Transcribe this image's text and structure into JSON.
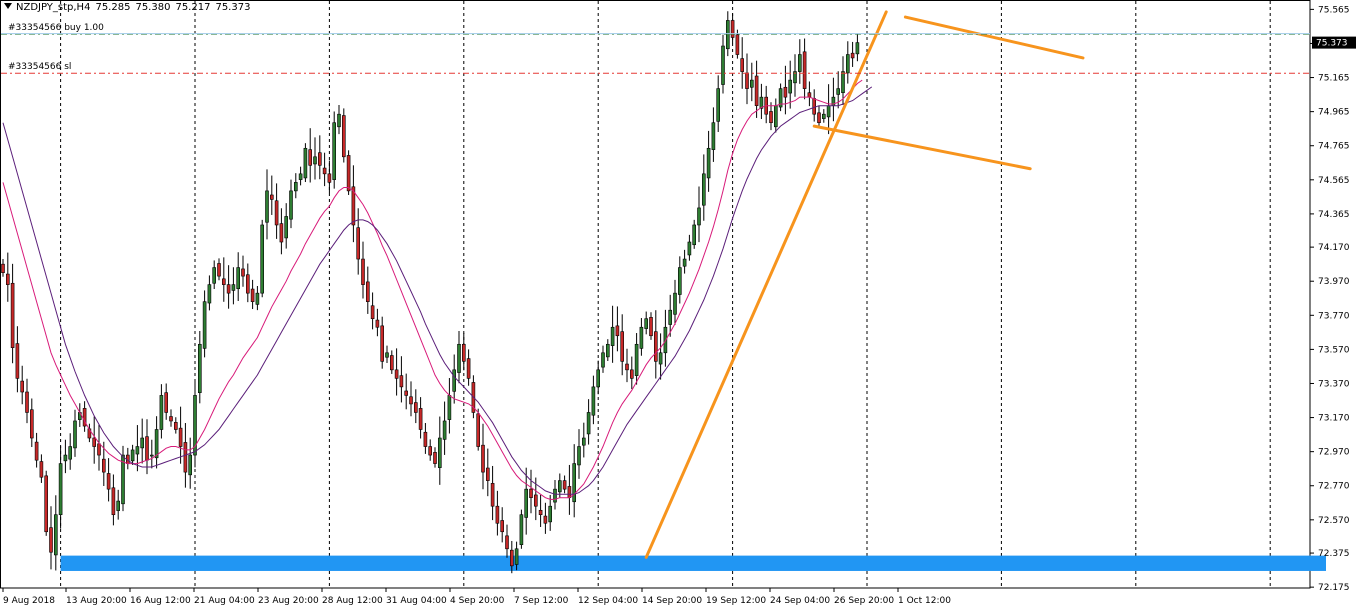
{
  "header": {
    "symbol": "NZDJPY_stp,H4",
    "open": "75.285",
    "high": "75.380",
    "low": "75.217",
    "close": "75.373"
  },
  "orders": {
    "buy_label": "#33354566 buy 1.00",
    "sl_label": "#33354566 sl",
    "buy_price": 75.42,
    "sl_price": 75.19,
    "buy_color": "#2e7d32",
    "sl_color": "#e53935"
  },
  "current_price_label": "75.373",
  "colors": {
    "bull_candle": "#2e7d32",
    "bear_candle": "#c62828",
    "ma_fast": "#d81b7a",
    "ma_slow": "#5b1f7a",
    "trendline": "#f7941d",
    "support_zone": "#2196f3",
    "grid": "#000000"
  },
  "chart_data": {
    "type": "candlestick",
    "timeframe": "H4",
    "ylim": [
      72.17,
      75.62
    ],
    "y_ticks": [
      "75.565",
      "75.365",
      "75.165",
      "74.965",
      "74.765",
      "74.565",
      "74.365",
      "74.170",
      "73.970",
      "73.770",
      "73.570",
      "73.370",
      "73.170",
      "72.970",
      "72.770",
      "72.570",
      "72.375",
      "72.175"
    ],
    "x_ticks": [
      "9 Aug 2018",
      "13 Aug 20:00",
      "16 Aug 12:00",
      "21 Aug 04:00",
      "23 Aug 20:00",
      "28 Aug 12:00",
      "31 Aug 04:00",
      "4 Sep 20:00",
      "7 Sep 12:00",
      "12 Sep 04:00",
      "14 Sep 20:00",
      "19 Sep 12:00",
      "24 Sep 04:00",
      "26 Sep 20:00",
      "1 Oct 12:00"
    ],
    "grid_x_indices": [
      12,
      40,
      68,
      96,
      124,
      152,
      180,
      208,
      236,
      264,
      292,
      320
    ],
    "support_zone": {
      "low": 72.27,
      "high": 72.36,
      "from_index": 12
    },
    "trendlines": [
      {
        "from": [
          134,
          72.35
        ],
        "to": [
          184,
          75.55
        ]
      },
      {
        "from": [
          188,
          75.52
        ],
        "to": [
          225,
          75.28
        ]
      },
      {
        "from": [
          169,
          74.88
        ],
        "to": [
          214,
          74.63
        ]
      }
    ],
    "close": [
      74.02,
      73.95,
      73.58,
      73.4,
      73.32,
      73.2,
      73.05,
      72.92,
      72.82,
      72.5,
      72.38,
      72.6,
      72.9,
      72.95,
      73.0,
      73.15,
      73.2,
      73.12,
      73.05,
      73.0,
      72.95,
      72.85,
      72.75,
      72.6,
      72.68,
      72.95,
      72.9,
      72.98,
      73.0,
      73.05,
      72.92,
      72.95,
      73.1,
      73.3,
      73.2,
      73.15,
      73.1,
      73.0,
      72.85,
      72.95,
      73.3,
      73.6,
      73.85,
      73.95,
      74.05,
      74.0,
      73.95,
      73.9,
      73.95,
      74.05,
      74.0,
      73.9,
      73.85,
      73.9,
      74.3,
      74.5,
      74.45,
      74.3,
      74.2,
      74.35,
      74.5,
      74.55,
      74.6,
      74.75,
      74.65,
      74.7,
      74.65,
      74.6,
      74.55,
      74.9,
      74.95,
      74.7,
      74.5,
      74.3,
      74.1,
      73.95,
      73.85,
      73.75,
      73.7,
      73.5,
      73.55,
      73.45,
      73.4,
      73.35,
      73.3,
      73.25,
      73.2,
      73.1,
      73.0,
      72.95,
      72.9,
      73.05,
      73.15,
      73.3,
      73.45,
      73.6,
      73.5,
      73.4,
      73.2,
      73.0,
      72.85,
      72.8,
      72.65,
      72.55,
      72.5,
      72.4,
      72.3,
      72.4,
      72.6,
      72.75,
      72.7,
      72.65,
      72.6,
      72.55,
      72.65,
      72.75,
      72.8,
      72.75,
      72.7,
      72.9,
      73.0,
      73.05,
      73.2,
      73.35,
      73.45,
      73.55,
      73.6,
      73.7,
      73.65,
      73.5,
      73.45,
      73.4,
      73.6,
      73.7,
      73.75,
      73.65,
      73.5,
      73.55,
      73.7,
      73.8,
      73.9,
      74.05,
      74.1,
      74.2,
      74.3,
      74.4,
      74.6,
      74.75,
      74.9,
      75.1,
      75.35,
      75.5,
      75.4,
      75.3,
      75.2,
      75.1,
      75.15,
      75.0,
      75.05,
      74.95,
      74.9,
      75.0,
      75.1,
      75.05,
      75.15,
      75.2,
      75.3,
      75.1,
      75.05,
      74.95,
      74.9,
      74.95,
      75.0,
      75.05,
      75.1,
      75.2,
      75.3,
      75.28,
      75.37
    ],
    "series": [
      {
        "name": "",
        "type": "moving_average",
        "values": [
          74.55,
          74.45,
          74.35,
          74.25,
          74.15,
          74.05,
          73.95,
          73.85,
          73.75,
          73.65,
          73.55,
          73.48,
          73.42,
          73.36,
          73.3,
          73.25,
          73.2,
          73.15,
          73.1,
          73.06,
          73.02,
          72.99,
          72.96,
          72.94,
          72.92,
          72.91,
          72.9,
          72.9,
          72.9,
          72.91,
          72.92,
          72.93,
          72.95,
          72.97,
          72.99,
          73.0,
          73.0,
          72.99,
          72.98,
          72.98,
          73.0,
          73.05,
          73.1,
          73.16,
          73.22,
          73.28,
          73.33,
          73.38,
          73.42,
          73.47,
          73.52,
          73.56,
          73.6,
          73.64,
          73.7,
          73.76,
          73.82,
          73.87,
          73.92,
          73.97,
          74.03,
          74.08,
          74.13,
          74.19,
          74.24,
          74.29,
          74.34,
          74.38,
          74.41,
          74.46,
          74.5,
          74.52,
          74.52,
          74.5,
          74.46,
          74.42,
          74.37,
          74.31,
          74.25,
          74.18,
          74.12,
          74.05,
          73.98,
          73.91,
          73.84,
          73.77,
          73.7,
          73.63,
          73.56,
          73.49,
          73.42,
          73.37,
          73.33,
          73.3,
          73.28,
          73.27,
          73.26,
          73.25,
          73.23,
          73.2,
          73.16,
          73.12,
          73.07,
          73.02,
          72.97,
          72.92,
          72.87,
          72.83,
          72.8,
          72.78,
          72.76,
          72.74,
          72.72,
          72.7,
          72.69,
          72.69,
          72.7,
          72.7,
          72.7,
          72.72,
          72.75,
          72.78,
          72.83,
          72.88,
          72.94,
          73.0,
          73.07,
          73.14,
          73.2,
          73.25,
          73.29,
          73.33,
          73.38,
          73.43,
          73.48,
          73.52,
          73.55,
          73.58,
          73.62,
          73.67,
          73.72,
          73.78,
          73.84,
          73.9,
          73.97,
          74.04,
          74.12,
          74.2,
          74.29,
          74.39,
          74.5,
          74.62,
          74.72,
          74.8,
          74.86,
          74.91,
          74.95,
          74.97,
          74.99,
          75.0,
          75.0,
          75.0,
          75.01,
          75.01,
          75.02,
          75.03,
          75.05,
          75.05,
          75.05,
          75.04,
          75.03,
          75.02,
          75.01,
          75.01,
          75.02,
          75.04,
          75.07,
          75.1,
          75.13,
          75.15
        ]
      },
      {
        "name": "",
        "type": "moving_average",
        "values": [
          74.9,
          74.8,
          74.7,
          74.6,
          74.5,
          74.4,
          74.3,
          74.2,
          74.1,
          74.0,
          73.9,
          73.8,
          73.7,
          73.6,
          73.52,
          73.44,
          73.37,
          73.3,
          73.24,
          73.18,
          73.13,
          73.08,
          73.04,
          73.0,
          72.97,
          72.94,
          72.92,
          72.9,
          72.89,
          72.88,
          72.88,
          72.88,
          72.89,
          72.9,
          72.91,
          72.92,
          72.93,
          72.94,
          72.95,
          72.96,
          72.97,
          72.99,
          73.01,
          73.04,
          73.07,
          73.1,
          73.14,
          73.18,
          73.22,
          73.26,
          73.3,
          73.34,
          73.38,
          73.42,
          73.47,
          73.52,
          73.57,
          73.62,
          73.67,
          73.72,
          73.77,
          73.82,
          73.87,
          73.92,
          73.97,
          74.02,
          74.07,
          74.11,
          74.15,
          74.19,
          74.23,
          74.27,
          74.3,
          74.32,
          74.33,
          74.33,
          74.32,
          74.3,
          74.27,
          74.23,
          74.19,
          74.14,
          74.09,
          74.03,
          73.97,
          73.91,
          73.85,
          73.79,
          73.72,
          73.66,
          73.6,
          73.54,
          73.49,
          73.45,
          73.41,
          73.38,
          73.35,
          73.32,
          73.29,
          73.26,
          73.22,
          73.18,
          73.14,
          73.09,
          73.04,
          72.99,
          72.94,
          72.9,
          72.86,
          72.83,
          72.8,
          72.78,
          72.76,
          72.74,
          72.73,
          72.72,
          72.72,
          72.72,
          72.72,
          72.72,
          72.73,
          72.75,
          72.77,
          72.8,
          72.84,
          72.88,
          72.93,
          72.98,
          73.03,
          73.08,
          73.13,
          73.17,
          73.21,
          73.25,
          73.29,
          73.33,
          73.37,
          73.41,
          73.45,
          73.49,
          73.53,
          73.58,
          73.63,
          73.68,
          73.74,
          73.8,
          73.86,
          73.93,
          74.0,
          74.08,
          74.16,
          74.25,
          74.34,
          74.42,
          74.5,
          74.57,
          74.63,
          74.69,
          74.74,
          74.78,
          74.82,
          74.85,
          74.88,
          74.9,
          74.92,
          74.94,
          74.96,
          74.97,
          74.98,
          74.99,
          75.0,
          75.0,
          75.0,
          75.0,
          75.0,
          75.01,
          75.02,
          75.03,
          75.05,
          75.07,
          75.09,
          75.11
        ]
      }
    ]
  }
}
